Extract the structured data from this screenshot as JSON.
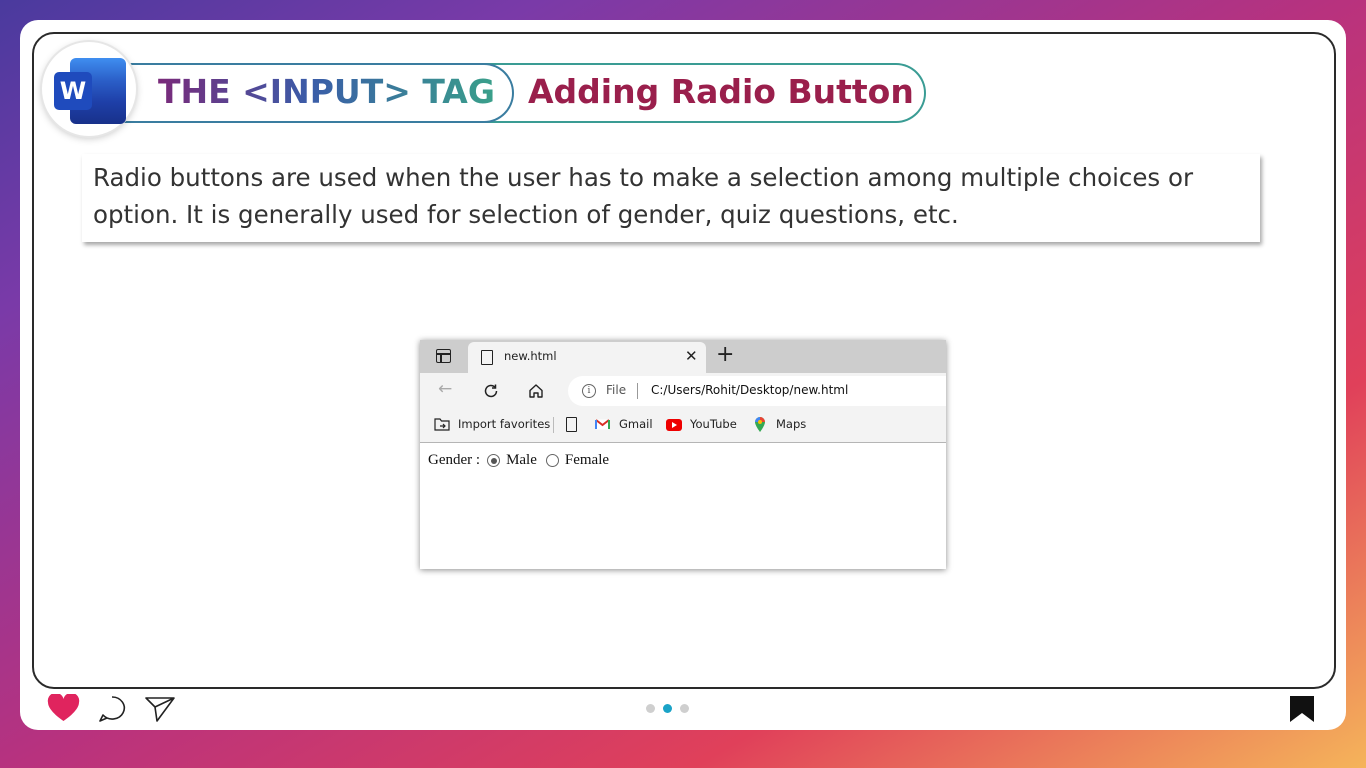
{
  "header": {
    "tag_title": "THE <INPUT> TAG",
    "subtitle": "Adding Radio Button",
    "logo_letter": "W"
  },
  "description": "Radio buttons are used when the user has to make a selection among multiple choices or option. It is generally used for selection of gender, quiz questions, etc.",
  "browser": {
    "tab_title": "new.html",
    "address": {
      "scheme_label": "File",
      "url": "C:/Users/Rohit/Desktop/new.html"
    },
    "bookmarks": [
      {
        "label": "Import favorites",
        "icon": "import-icon"
      },
      {
        "label": "Gmail",
        "icon": "gmail-icon"
      },
      {
        "label": "YouTube",
        "icon": "youtube-icon"
      },
      {
        "label": "Maps",
        "icon": "maps-icon"
      }
    ],
    "page": {
      "label": "Gender :",
      "options": [
        {
          "label": "Male",
          "checked": true
        },
        {
          "label": "Female",
          "checked": false
        }
      ]
    }
  },
  "pagination": {
    "total": 3,
    "active": 2
  },
  "colors": {
    "subtitle": "#9a1f4c",
    "heart": "#e0245e",
    "dot_active": "#1aa3c7"
  }
}
